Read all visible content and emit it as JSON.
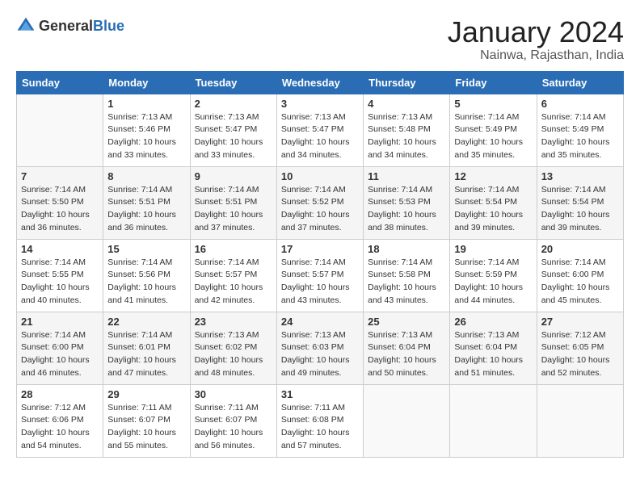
{
  "header": {
    "logo_general": "General",
    "logo_blue": "Blue",
    "month": "January 2024",
    "location": "Nainwa, Rajasthan, India"
  },
  "days_of_week": [
    "Sunday",
    "Monday",
    "Tuesday",
    "Wednesday",
    "Thursday",
    "Friday",
    "Saturday"
  ],
  "weeks": [
    [
      {
        "day": "",
        "sunrise": "",
        "sunset": "",
        "daylight": ""
      },
      {
        "day": "1",
        "sunrise": "Sunrise: 7:13 AM",
        "sunset": "Sunset: 5:46 PM",
        "daylight": "Daylight: 10 hours and 33 minutes."
      },
      {
        "day": "2",
        "sunrise": "Sunrise: 7:13 AM",
        "sunset": "Sunset: 5:47 PM",
        "daylight": "Daylight: 10 hours and 33 minutes."
      },
      {
        "day": "3",
        "sunrise": "Sunrise: 7:13 AM",
        "sunset": "Sunset: 5:47 PM",
        "daylight": "Daylight: 10 hours and 34 minutes."
      },
      {
        "day": "4",
        "sunrise": "Sunrise: 7:13 AM",
        "sunset": "Sunset: 5:48 PM",
        "daylight": "Daylight: 10 hours and 34 minutes."
      },
      {
        "day": "5",
        "sunrise": "Sunrise: 7:14 AM",
        "sunset": "Sunset: 5:49 PM",
        "daylight": "Daylight: 10 hours and 35 minutes."
      },
      {
        "day": "6",
        "sunrise": "Sunrise: 7:14 AM",
        "sunset": "Sunset: 5:49 PM",
        "daylight": "Daylight: 10 hours and 35 minutes."
      }
    ],
    [
      {
        "day": "7",
        "sunrise": "Sunrise: 7:14 AM",
        "sunset": "Sunset: 5:50 PM",
        "daylight": "Daylight: 10 hours and 36 minutes."
      },
      {
        "day": "8",
        "sunrise": "Sunrise: 7:14 AM",
        "sunset": "Sunset: 5:51 PM",
        "daylight": "Daylight: 10 hours and 36 minutes."
      },
      {
        "day": "9",
        "sunrise": "Sunrise: 7:14 AM",
        "sunset": "Sunset: 5:51 PM",
        "daylight": "Daylight: 10 hours and 37 minutes."
      },
      {
        "day": "10",
        "sunrise": "Sunrise: 7:14 AM",
        "sunset": "Sunset: 5:52 PM",
        "daylight": "Daylight: 10 hours and 37 minutes."
      },
      {
        "day": "11",
        "sunrise": "Sunrise: 7:14 AM",
        "sunset": "Sunset: 5:53 PM",
        "daylight": "Daylight: 10 hours and 38 minutes."
      },
      {
        "day": "12",
        "sunrise": "Sunrise: 7:14 AM",
        "sunset": "Sunset: 5:54 PM",
        "daylight": "Daylight: 10 hours and 39 minutes."
      },
      {
        "day": "13",
        "sunrise": "Sunrise: 7:14 AM",
        "sunset": "Sunset: 5:54 PM",
        "daylight": "Daylight: 10 hours and 39 minutes."
      }
    ],
    [
      {
        "day": "14",
        "sunrise": "Sunrise: 7:14 AM",
        "sunset": "Sunset: 5:55 PM",
        "daylight": "Daylight: 10 hours and 40 minutes."
      },
      {
        "day": "15",
        "sunrise": "Sunrise: 7:14 AM",
        "sunset": "Sunset: 5:56 PM",
        "daylight": "Daylight: 10 hours and 41 minutes."
      },
      {
        "day": "16",
        "sunrise": "Sunrise: 7:14 AM",
        "sunset": "Sunset: 5:57 PM",
        "daylight": "Daylight: 10 hours and 42 minutes."
      },
      {
        "day": "17",
        "sunrise": "Sunrise: 7:14 AM",
        "sunset": "Sunset: 5:57 PM",
        "daylight": "Daylight: 10 hours and 43 minutes."
      },
      {
        "day": "18",
        "sunrise": "Sunrise: 7:14 AM",
        "sunset": "Sunset: 5:58 PM",
        "daylight": "Daylight: 10 hours and 43 minutes."
      },
      {
        "day": "19",
        "sunrise": "Sunrise: 7:14 AM",
        "sunset": "Sunset: 5:59 PM",
        "daylight": "Daylight: 10 hours and 44 minutes."
      },
      {
        "day": "20",
        "sunrise": "Sunrise: 7:14 AM",
        "sunset": "Sunset: 6:00 PM",
        "daylight": "Daylight: 10 hours and 45 minutes."
      }
    ],
    [
      {
        "day": "21",
        "sunrise": "Sunrise: 7:14 AM",
        "sunset": "Sunset: 6:00 PM",
        "daylight": "Daylight: 10 hours and 46 minutes."
      },
      {
        "day": "22",
        "sunrise": "Sunrise: 7:14 AM",
        "sunset": "Sunset: 6:01 PM",
        "daylight": "Daylight: 10 hours and 47 minutes."
      },
      {
        "day": "23",
        "sunrise": "Sunrise: 7:13 AM",
        "sunset": "Sunset: 6:02 PM",
        "daylight": "Daylight: 10 hours and 48 minutes."
      },
      {
        "day": "24",
        "sunrise": "Sunrise: 7:13 AM",
        "sunset": "Sunset: 6:03 PM",
        "daylight": "Daylight: 10 hours and 49 minutes."
      },
      {
        "day": "25",
        "sunrise": "Sunrise: 7:13 AM",
        "sunset": "Sunset: 6:04 PM",
        "daylight": "Daylight: 10 hours and 50 minutes."
      },
      {
        "day": "26",
        "sunrise": "Sunrise: 7:13 AM",
        "sunset": "Sunset: 6:04 PM",
        "daylight": "Daylight: 10 hours and 51 minutes."
      },
      {
        "day": "27",
        "sunrise": "Sunrise: 7:12 AM",
        "sunset": "Sunset: 6:05 PM",
        "daylight": "Daylight: 10 hours and 52 minutes."
      }
    ],
    [
      {
        "day": "28",
        "sunrise": "Sunrise: 7:12 AM",
        "sunset": "Sunset: 6:06 PM",
        "daylight": "Daylight: 10 hours and 54 minutes."
      },
      {
        "day": "29",
        "sunrise": "Sunrise: 7:11 AM",
        "sunset": "Sunset: 6:07 PM",
        "daylight": "Daylight: 10 hours and 55 minutes."
      },
      {
        "day": "30",
        "sunrise": "Sunrise: 7:11 AM",
        "sunset": "Sunset: 6:07 PM",
        "daylight": "Daylight: 10 hours and 56 minutes."
      },
      {
        "day": "31",
        "sunrise": "Sunrise: 7:11 AM",
        "sunset": "Sunset: 6:08 PM",
        "daylight": "Daylight: 10 hours and 57 minutes."
      },
      {
        "day": "",
        "sunrise": "",
        "sunset": "",
        "daylight": ""
      },
      {
        "day": "",
        "sunrise": "",
        "sunset": "",
        "daylight": ""
      },
      {
        "day": "",
        "sunrise": "",
        "sunset": "",
        "daylight": ""
      }
    ]
  ]
}
